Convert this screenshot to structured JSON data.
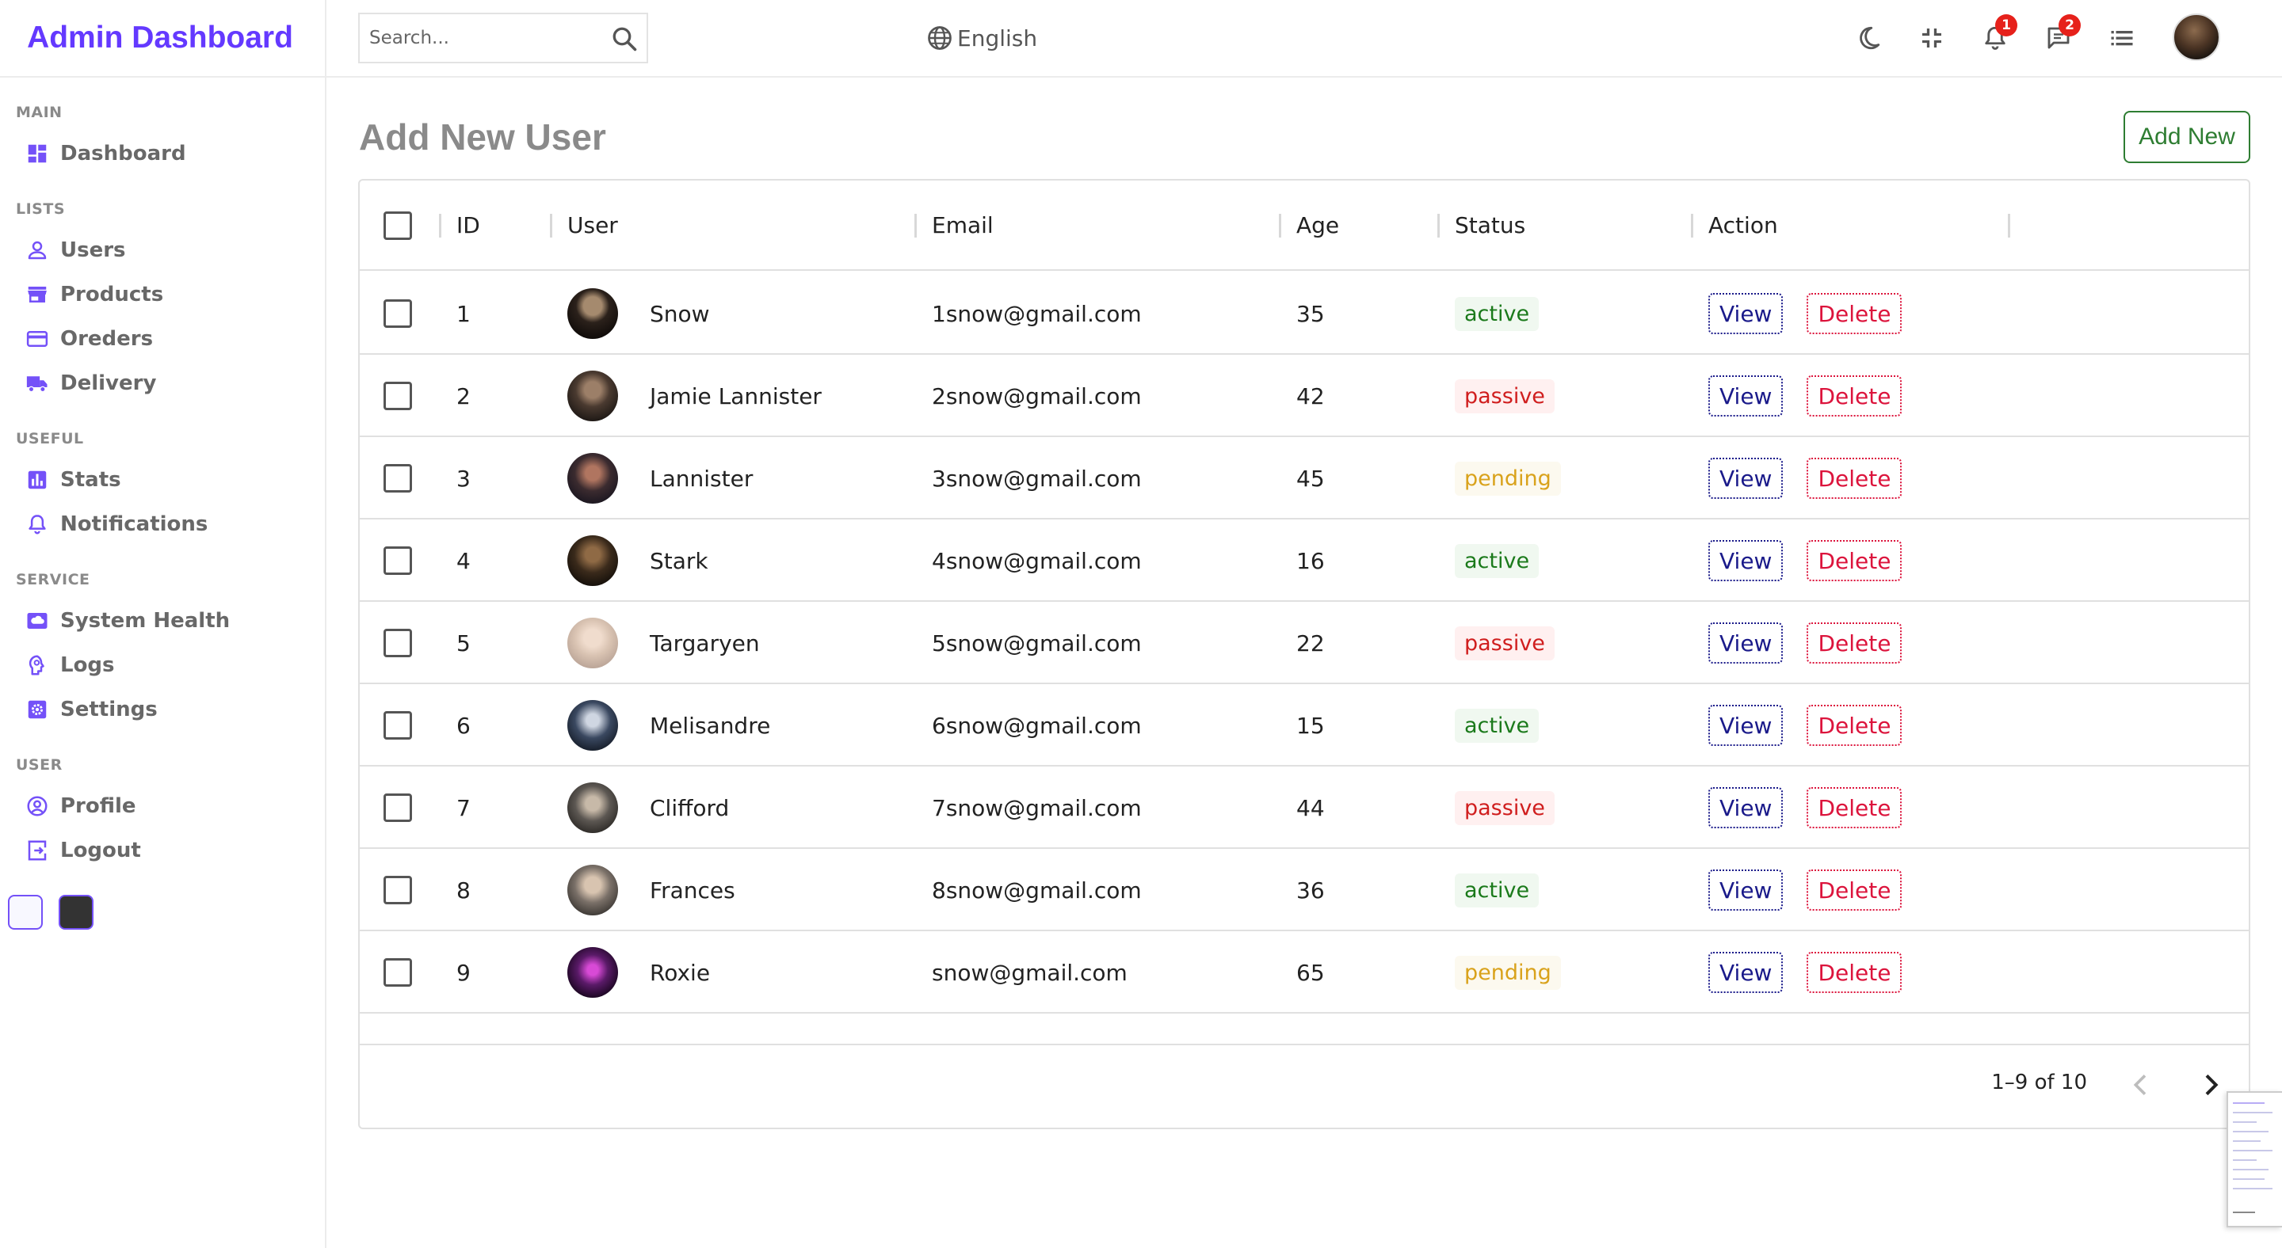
{
  "app": {
    "logo": "Admin Dashboard"
  },
  "header": {
    "search_placeholder": "Search...",
    "language": "English",
    "notifications_count": "1",
    "messages_count": "2"
  },
  "sidebar": {
    "sections": [
      {
        "title": "MAIN",
        "items": [
          {
            "label": "Dashboard",
            "icon": "dashboard-icon"
          }
        ]
      },
      {
        "title": "LISTS",
        "items": [
          {
            "label": "Users",
            "icon": "person-icon"
          },
          {
            "label": "Products",
            "icon": "store-icon"
          },
          {
            "label": "Oreders",
            "icon": "credit-card-icon"
          },
          {
            "label": "Delivery",
            "icon": "truck-icon"
          }
        ]
      },
      {
        "title": "USEFUL",
        "items": [
          {
            "label": "Stats",
            "icon": "bar-chart-icon"
          },
          {
            "label": "Notifications",
            "icon": "bell-icon"
          }
        ]
      },
      {
        "title": "SERVICE",
        "items": [
          {
            "label": "System Health",
            "icon": "cloud-health-icon"
          },
          {
            "label": "Logs",
            "icon": "psychology-icon"
          },
          {
            "label": "Settings",
            "icon": "settings-icon"
          }
        ]
      },
      {
        "title": "USER",
        "items": [
          {
            "label": "Profile",
            "icon": "account-circle-icon"
          },
          {
            "label": "Logout",
            "icon": "logout-icon"
          }
        ]
      }
    ]
  },
  "main": {
    "title": "Add New User",
    "add_new_label": "Add New"
  },
  "table": {
    "columns": [
      "ID",
      "User",
      "Email",
      "Age",
      "Status",
      "Action"
    ],
    "view_label": "View",
    "delete_label": "Delete",
    "rows": [
      {
        "id": "1",
        "user": "Snow",
        "email": "1snow@gmail.com",
        "age": "35",
        "status": "active"
      },
      {
        "id": "2",
        "user": "Jamie Lannister",
        "email": "2snow@gmail.com",
        "age": "42",
        "status": "passive"
      },
      {
        "id": "3",
        "user": "Lannister",
        "email": "3snow@gmail.com",
        "age": "45",
        "status": "pending"
      },
      {
        "id": "4",
        "user": "Stark",
        "email": "4snow@gmail.com",
        "age": "16",
        "status": "active"
      },
      {
        "id": "5",
        "user": "Targaryen",
        "email": "5snow@gmail.com",
        "age": "22",
        "status": "passive"
      },
      {
        "id": "6",
        "user": "Melisandre",
        "email": "6snow@gmail.com",
        "age": "15",
        "status": "active"
      },
      {
        "id": "7",
        "user": "Clifford",
        "email": "7snow@gmail.com",
        "age": "44",
        "status": "passive"
      },
      {
        "id": "8",
        "user": "Frances",
        "email": "8snow@gmail.com",
        "age": "36",
        "status": "active"
      },
      {
        "id": "9",
        "user": "Roxie",
        "email": "snow@gmail.com",
        "age": "65",
        "status": "pending"
      }
    ],
    "pagination": "1–9 of 10"
  },
  "colors": {
    "brand": "#6439ff",
    "icon": "#7451f8",
    "active": "#1b7a1b",
    "passive": "#d01e1e",
    "pending": "#d9a21b",
    "view": "#1a1a8a",
    "delete": "#dc143c"
  }
}
